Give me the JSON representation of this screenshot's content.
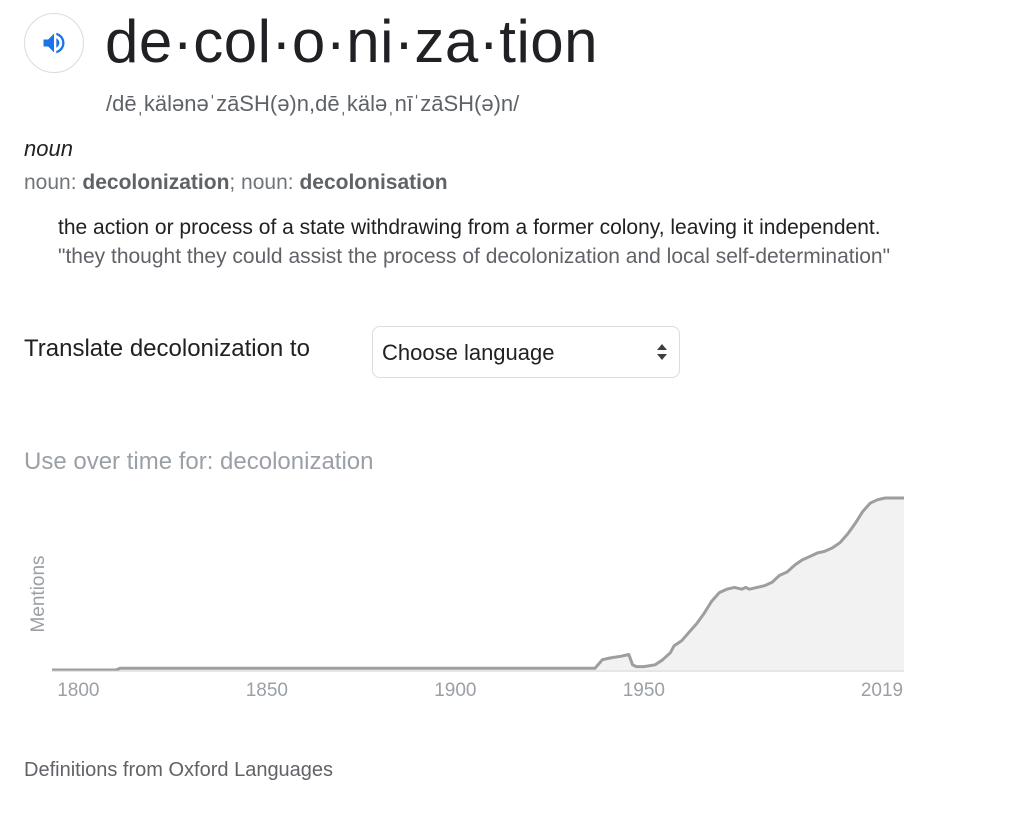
{
  "entry": {
    "headword": "de·col·o·ni·za·tion",
    "phonetic": "/dēˌkälənəˈzāSH(ə)n,dēˌkäləˌnīˈzāSH(ə)n/",
    "listen_icon": "speaker-icon",
    "part_of_speech": "noun",
    "forms_prefix_1": "noun: ",
    "form_1": "decolonization",
    "forms_sep": "; noun: ",
    "form_2": "decolonisation",
    "definition": "the action or process of a state withdrawing from a former colony, leaving it independent.",
    "example": "\"they thought they could assist the process of decolonization and local self-determination\""
  },
  "translate": {
    "label": "Translate decolonization to",
    "selected": "Choose language",
    "icon": "updown-arrows-icon"
  },
  "usage": {
    "title": "Use over time for: decolonization"
  },
  "chart_data": {
    "type": "area",
    "title": "Use over time for: decolonization",
    "xlabel": "",
    "ylabel": "Mentions",
    "x_ticks": [
      "1800",
      "1850",
      "1900",
      "1950",
      "2019"
    ],
    "xlim": [
      1793,
      2019
    ],
    "ylim": [
      0,
      100
    ],
    "grid": false,
    "legend": "none",
    "line_color": "#9e9e9e",
    "fill_color": "#f2f2f2",
    "series": [
      {
        "x": [
          1793,
          1810,
          1811,
          1900,
          1937,
          1939,
          1941,
          1944,
          1946,
          1947,
          1948,
          1950,
          1953,
          1955,
          1957,
          1958,
          1960,
          1962,
          1964,
          1966,
          1968,
          1970,
          1972,
          1974,
          1976,
          1977,
          1978,
          1980,
          1982,
          1984,
          1985,
          1986,
          1988,
          1990,
          1992,
          1994,
          1996,
          1998,
          2000,
          2002,
          2004,
          2006,
          2008,
          2010,
          2012,
          2014,
          2016,
          2019
        ],
        "y": [
          0,
          0,
          1,
          1,
          1,
          6,
          7,
          8,
          9,
          3,
          2,
          2,
          3,
          6,
          10,
          14,
          17,
          22,
          27,
          33,
          40,
          45,
          47,
          48,
          47,
          48,
          47,
          48,
          49,
          51,
          53,
          55,
          57,
          61,
          64,
          66,
          68,
          69,
          71,
          74,
          79,
          85,
          92,
          97,
          99,
          100,
          100,
          100
        ]
      }
    ]
  },
  "footer": {
    "source": "Definitions from Oxford Languages"
  }
}
